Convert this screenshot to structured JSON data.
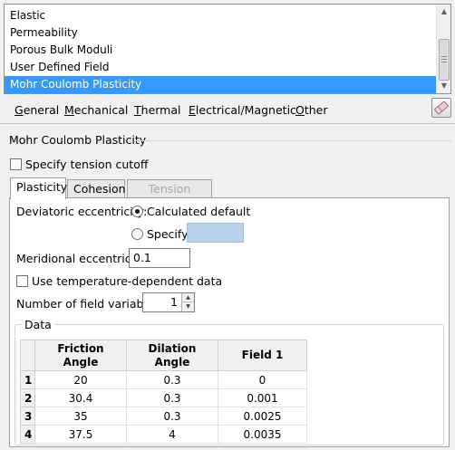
{
  "material_list": {
    "items": [
      {
        "label": "Elastic",
        "selected": false
      },
      {
        "label": "Permeability",
        "selected": false
      },
      {
        "label": "Porous Bulk Moduli",
        "selected": false
      },
      {
        "label": "User Defined Field",
        "selected": false
      },
      {
        "label": "Mohr Coulomb Plasticity",
        "selected": true
      }
    ]
  },
  "menubar": {
    "general": {
      "u": "G",
      "rest": "eneral"
    },
    "mechanical": {
      "u": "M",
      "rest": "echanical"
    },
    "thermal": {
      "u": "T",
      "rest": "hermal"
    },
    "electrical": {
      "u": "E",
      "rest": "lectrical/Magnetic"
    },
    "other": {
      "u": "O",
      "rest": "ther"
    },
    "eraser_icon": "eraser-icon"
  },
  "section": {
    "title": "Mohr Coulomb Plasticity",
    "tension_cutoff_label": "Specify tension cutoff",
    "tension_cutoff_checked": false
  },
  "tabs": [
    {
      "label": "Plasticity",
      "state": "active"
    },
    {
      "label": "Cohesion",
      "state": "normal"
    },
    {
      "label": "Tension Cutoff",
      "state": "disabled"
    }
  ],
  "plasticity": {
    "deviatoric_label": "Deviatoric eccentricity:",
    "calculated_default_label": "Calculated default",
    "specify_label": "Specify:",
    "specify_value": "",
    "deviatoric_choice": "calculated_default",
    "meridional_label": "Meridional eccentricity",
    "meridional_value": "0.1",
    "temp_dependent_label": "Use temperature-dependent data",
    "temp_dependent_checked": false,
    "field_vars_label": "Number of field variables:",
    "field_vars_value": "1"
  },
  "data_group": {
    "title": "Data",
    "columns": [
      "Friction\nAngle",
      "Dilation\nAngle",
      "Field 1"
    ],
    "rows": [
      {
        "index": "1",
        "cells": [
          "20",
          "0.3",
          "0"
        ]
      },
      {
        "index": "2",
        "cells": [
          "30.4",
          "0.3",
          "0.001"
        ]
      },
      {
        "index": "3",
        "cells": [
          "35",
          "0.3",
          "0.0025"
        ]
      },
      {
        "index": "4",
        "cells": [
          "37.5",
          "4",
          "0.0035"
        ]
      }
    ]
  }
}
